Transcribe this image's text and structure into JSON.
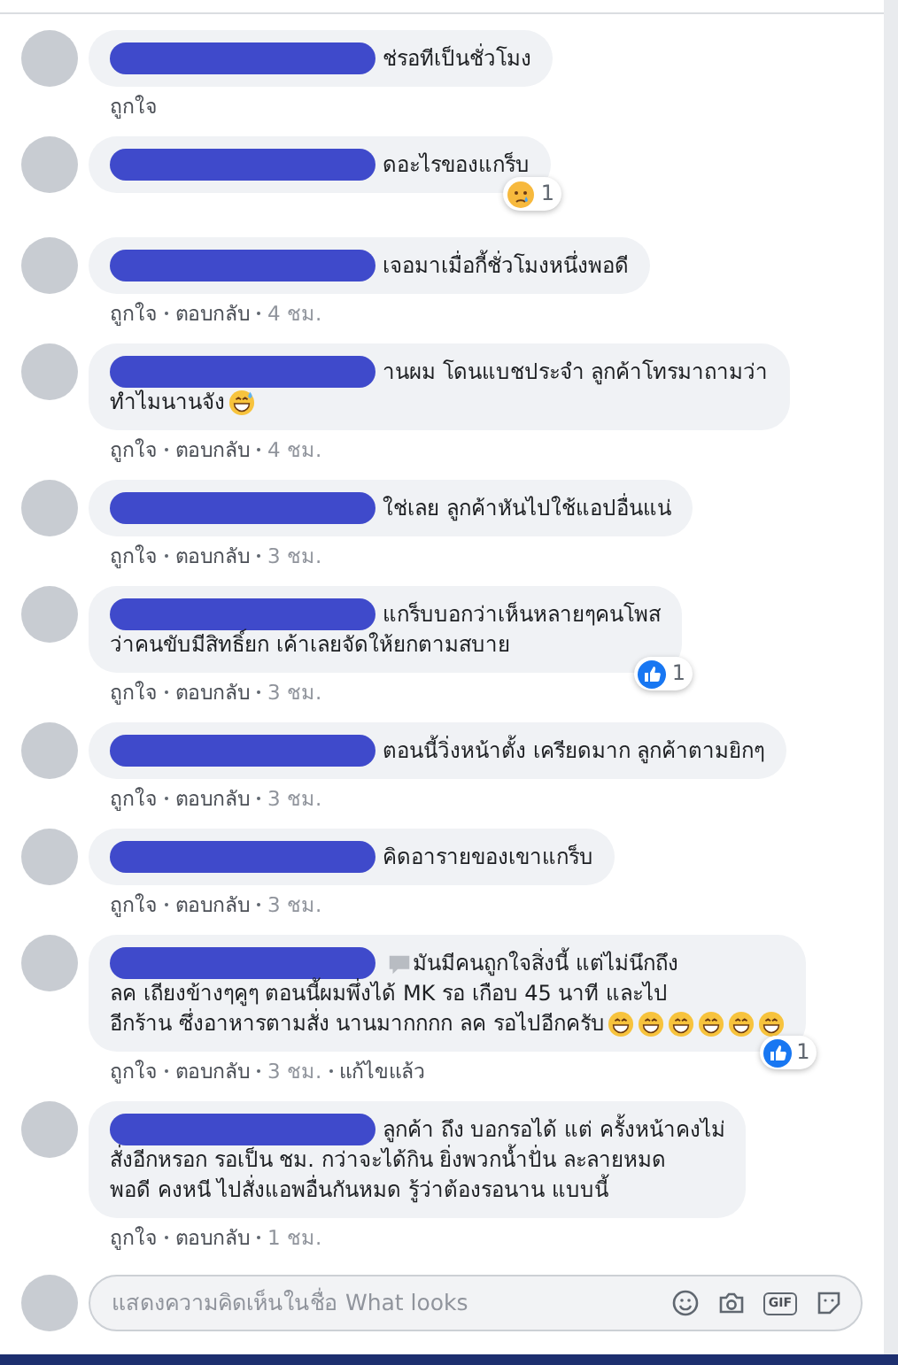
{
  "comments": [
    {
      "redacted": true,
      "lines": [
        "ช่รอทีเป็นชั่วโมง"
      ],
      "meta": [
        {
          "kind": "link",
          "text": "ถูกใจ"
        }
      ]
    },
    {
      "redacted": true,
      "lines": [
        "ดอะไรของแกร็บ"
      ],
      "reaction": {
        "kind": "sad",
        "count": "1"
      }
    },
    {
      "redacted": true,
      "lines": [
        "เจอมาเมื่อกี้ชั่วโมงหนึ่งพอดี"
      ],
      "meta": [
        {
          "kind": "link",
          "text": "ถูกใจ"
        },
        {
          "kind": "link",
          "text": "ตอบกลับ"
        },
        {
          "kind": "time",
          "text": "4 ชม."
        }
      ]
    },
    {
      "redacted": true,
      "lines": [
        "านผม โดนแบชประจำ ลูกค้าโทรมาถามว่า",
        "ทำไมนานจัง"
      ],
      "emoji_after": [
        {
          "kind": "sweat-smile"
        }
      ],
      "meta": [
        {
          "kind": "link",
          "text": "ถูกใจ"
        },
        {
          "kind": "link",
          "text": "ตอบกลับ"
        },
        {
          "kind": "time",
          "text": "4 ชม."
        }
      ]
    },
    {
      "redacted": true,
      "lines": [
        "ใช่เลย ลูกค้าหันไปใช้แอปอื่นแน่"
      ],
      "meta": [
        {
          "kind": "link",
          "text": "ถูกใจ"
        },
        {
          "kind": "link",
          "text": "ตอบกลับ"
        },
        {
          "kind": "time",
          "text": "3 ชม."
        }
      ]
    },
    {
      "redacted": true,
      "lines": [
        "แกร็บบอกว่าเห็นหลายๆคนโพส",
        "ว่าคนขับมีสิทธิ์ยก เค้าเลยจัดให้ยกตามสบาย"
      ],
      "reaction": {
        "kind": "like",
        "count": "1"
      },
      "meta": [
        {
          "kind": "link",
          "text": "ถูกใจ"
        },
        {
          "kind": "link",
          "text": "ตอบกลับ"
        },
        {
          "kind": "time",
          "text": "3 ชม."
        }
      ]
    },
    {
      "redacted": true,
      "lines": [
        "ตอนนี้วิ่งหน้าตั้ง เครียดมาก ลูกค้าตามยิกๆ"
      ],
      "meta": [
        {
          "kind": "link",
          "text": "ถูกใจ"
        },
        {
          "kind": "link",
          "text": "ตอบกลับ"
        },
        {
          "kind": "time",
          "text": "3 ชม."
        }
      ]
    },
    {
      "redacted": true,
      "lines": [
        "คิดอารายของเขาแกร็บ"
      ],
      "meta": [
        {
          "kind": "link",
          "text": "ถูกใจ"
        },
        {
          "kind": "link",
          "text": "ตอบกลับ"
        },
        {
          "kind": "time",
          "text": "3 ชม."
        }
      ]
    },
    {
      "redacted": true,
      "emoji_before": [
        {
          "kind": "speech"
        }
      ],
      "lines": [
        "มันมีคนถูกใจสิ่งนี้ แต่ไม่นึกถึง",
        "ลค เถียงข้างๆคูๆ ตอนนี้ผมพึ่งได้ MK รอ เกือบ 45 นาที และไป",
        "อีกร้าน ซึ่งอาหารตามสั่ง นานมากกกก ลค รอไปอีกครับ"
      ],
      "emoji_after": [
        {
          "kind": "grin"
        },
        {
          "kind": "grin"
        },
        {
          "kind": "grin"
        },
        {
          "kind": "grin"
        },
        {
          "kind": "grin"
        },
        {
          "kind": "grin"
        }
      ],
      "reaction": {
        "kind": "like",
        "count": "1"
      },
      "meta": [
        {
          "kind": "link",
          "text": "ถูกใจ"
        },
        {
          "kind": "link",
          "text": "ตอบกลับ"
        },
        {
          "kind": "time",
          "text": "3 ชม."
        },
        {
          "kind": "link",
          "text": "แก้ไขแล้ว"
        }
      ]
    },
    {
      "redacted": true,
      "lines": [
        "ลูกค้า ถึง บอกรอได้ แต่ ครั้งหน้าคงไม่",
        "สั่งอีกหรอก รอเป็น ชม. กว่าจะได้กิน ยิ่งพวกน้ำปั่น ละลายหมด",
        "พอดี คงหนี ไปสั่งแอพอื่นกันหมด รู้ว่าต้องรอนาน แบบนี้"
      ],
      "meta": [
        {
          "kind": "link",
          "text": "ถูกใจ"
        },
        {
          "kind": "link",
          "text": "ตอบกลับ"
        },
        {
          "kind": "time",
          "text": "1 ชม."
        }
      ]
    }
  ],
  "composer": {
    "placeholder": "แสดงความคิดเห็นในชื่อ What looks",
    "gif_label": "GIF"
  }
}
